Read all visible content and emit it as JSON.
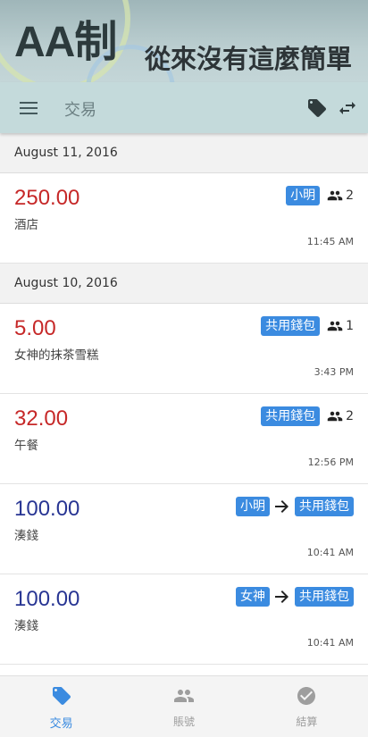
{
  "banner": {
    "brand": "AA制",
    "slogan": "從來沒有這麼簡單"
  },
  "toolbar": {
    "title": "交易",
    "menu_icon": "menu-icon",
    "tag_icon": "tag-icon",
    "swap_icon": "swap-icon"
  },
  "groups": [
    {
      "date": "August 11, 2016",
      "transactions": [
        {
          "amount": "250.00",
          "type": "expense",
          "description": "酒店",
          "chip": "小明",
          "people": "2",
          "time": "11:45 AM"
        }
      ]
    },
    {
      "date": "August 10, 2016",
      "transactions": [
        {
          "amount": "5.00",
          "type": "expense",
          "description": "女神的抹茶雪糕",
          "chip": "共用錢包",
          "people": "1",
          "time": "3:43 PM"
        },
        {
          "amount": "32.00",
          "type": "expense",
          "description": "午餐",
          "chip": "共用錢包",
          "people": "2",
          "time": "12:56 PM"
        },
        {
          "amount": "100.00",
          "type": "transfer",
          "description": "湊錢",
          "from": "小明",
          "to": "共用錢包",
          "time": "10:41 AM"
        },
        {
          "amount": "100.00",
          "type": "transfer",
          "description": "湊錢",
          "from": "女神",
          "to": "共用錢包",
          "time": "10:41 AM"
        }
      ]
    }
  ],
  "bottom_nav": {
    "items": [
      {
        "label": "交易",
        "icon": "tag-icon",
        "active": true
      },
      {
        "label": "賬號",
        "icon": "people-icon",
        "active": false
      },
      {
        "label": "結算",
        "icon": "check-circle-icon",
        "active": false
      }
    ]
  },
  "colors": {
    "accent": "#3b8be0",
    "expense": "#c62828",
    "transfer": "#283593",
    "toolbar": "#c4dadb"
  }
}
